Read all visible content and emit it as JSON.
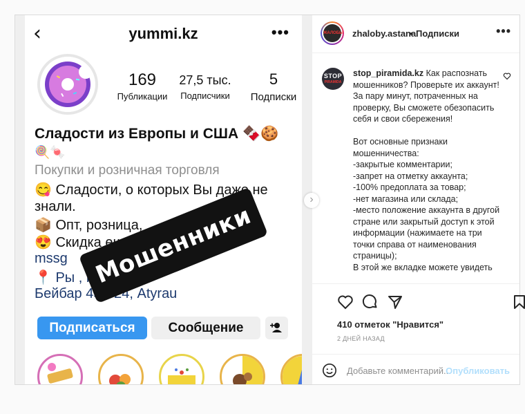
{
  "media": {
    "profile": {
      "username": "yummi.kz",
      "back_glyph": "‹",
      "more_glyph": "•••",
      "stats": [
        {
          "num": "169",
          "label": "Публикации"
        },
        {
          "num": "27,5 тыс.",
          "label": "Подписчики"
        },
        {
          "num": "5",
          "label": "Подписки"
        }
      ],
      "name": "Сладости из Европы и США 🍫🍪",
      "name_line2": "🍭🍬",
      "category": "Покупки и розничная торговля",
      "bio_lines": [
        "😋 Сладости, о которых Вы даже не",
        "знали.",
        "📦 Опт, розница,",
        "😍 Скидка                     ещё",
        "mssg",
        "📍 Ры              , проспект",
        "Бейбар          45Б/24, Atyrau"
      ],
      "follow_label": "Подписаться",
      "message_label": "Сообщение"
    },
    "stamp_text": "Мошенники",
    "next_arrow": "›"
  },
  "header": {
    "username": "zhaloby.astana",
    "separator": "•",
    "follow_label": "Подписки",
    "more_glyph": "•••",
    "avatar_text": "ЖАЛОБЫ"
  },
  "comment": {
    "username": "stop_piramida.kz",
    "avatar_line1": "STOP",
    "avatar_line2": "PIRAMIDA",
    "text_lines": [
      "Как распознать мошенников? Проверьте их аккаунт! За пару минут, потраченных на проверку, Вы сможете обезопасить себя и свои сбережения!",
      "",
      "Вот основные признаки мошенничества:",
      "-закрытые комментарии;",
      "-запрет на отметку аккаунта;",
      "-100% предоплата за товар;",
      "-нет магазина или склада;",
      "-место положение аккаунта в другой стране или закрытый доступ к этой информации (нажимаете на три точки справа от наименования страницы);",
      "В этой же вкладке можете увидеть"
    ]
  },
  "engagement": {
    "likes": "410 отметок \"Нравится\"",
    "time_ago": "2 ДНЕЙ НАЗАД"
  },
  "add_comment": {
    "placeholder": "Добавьте комментарий...",
    "publish_label": "Опубликовать"
  },
  "colors": {
    "follow_blue": "#3897f0",
    "publish_disabled": "#b2dffc",
    "muted": "#8e8e8e",
    "stamp_bg": "#121212"
  }
}
